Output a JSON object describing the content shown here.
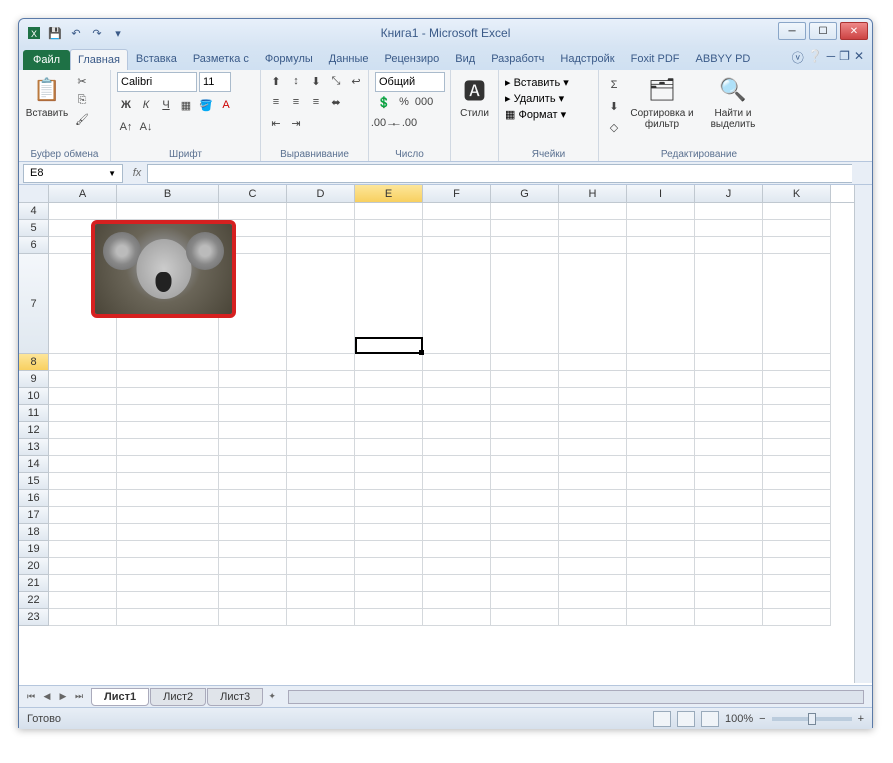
{
  "window": {
    "title": "Книга1 - Microsoft Excel"
  },
  "tabs": {
    "file": "Файл",
    "items": [
      "Главная",
      "Вставка",
      "Разметка с",
      "Формулы",
      "Данные",
      "Рецензиро",
      "Вид",
      "Разработч",
      "Надстройк",
      "Foxit PDF",
      "ABBYY PD"
    ],
    "active_index": 0
  },
  "ribbon": {
    "clipboard": {
      "label": "Буфер обмена",
      "paste": "Вставить"
    },
    "font": {
      "label": "Шрифт",
      "name": "Calibri",
      "size": "11"
    },
    "alignment": {
      "label": "Выравнивание"
    },
    "number": {
      "label": "Число",
      "format": "Общий"
    },
    "styles": {
      "label": "",
      "btn": "Стили"
    },
    "cells": {
      "label": "Ячейки",
      "insert": "Вставить",
      "delete": "Удалить",
      "format": "Формат"
    },
    "editing": {
      "label": "Редактирование",
      "sort": "Сортировка и фильтр",
      "find": "Найти и выделить"
    }
  },
  "formulabar": {
    "namebox": "E8",
    "fx": "fx"
  },
  "grid": {
    "columns": [
      "A",
      "B",
      "C",
      "D",
      "E",
      "F",
      "G",
      "H",
      "I",
      "J",
      "K"
    ],
    "rows": [
      4,
      5,
      6,
      7,
      8,
      9,
      10,
      11,
      12,
      13,
      14,
      15,
      16,
      17,
      18,
      19,
      20,
      21,
      22,
      23
    ],
    "active_col": "E",
    "active_row": 8,
    "tall_row": 7
  },
  "sheets": {
    "tabs": [
      "Лист1",
      "Лист2",
      "Лист3"
    ],
    "active": 0
  },
  "status": {
    "ready": "Готово",
    "zoom": "100%"
  }
}
